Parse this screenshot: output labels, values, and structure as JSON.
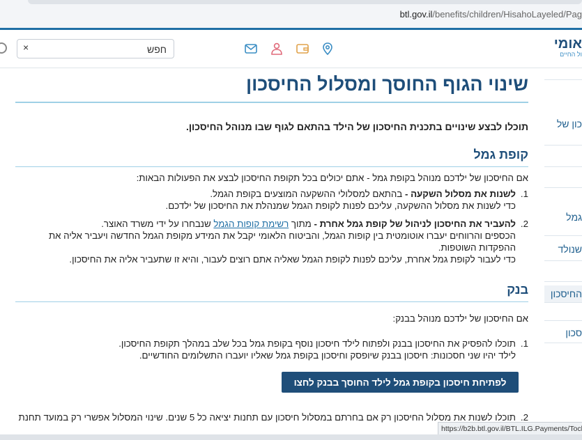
{
  "browser": {
    "url_domain": "btl.gov.il",
    "url_path": "/benefits/children/HisahoLayeled/Pag"
  },
  "header": {
    "logo_line1": "אומי",
    "logo_line2": "ול החיים",
    "icons": [
      "mail-icon",
      "person-icon",
      "wallet-icon",
      "location-pin-icon"
    ],
    "search_placeholder": "חפש",
    "clear_label": "×"
  },
  "sidebar": {
    "items": [
      "כון של",
      "גמל",
      "שנולד",
      "החיסכון",
      "סכון"
    ]
  },
  "main": {
    "title": "שינוי הגוף החוסך ומסלול החיסכון",
    "intro": "תוכלו לבצע שינויים בתכנית החיסכון של הילד בהתאם לגוף שבו מנוהל החיסכון.",
    "kupat_gemel": {
      "heading": "קופת גמל",
      "lead": "אם החיסכון של ילדכם מנוהל בקופת גמל - אתם יכולים בכל תקופת החיסכון לבצע את הפעולות הבאות:",
      "item1": {
        "num": "1.",
        "bold": "לשנות את מסלול השקעה -",
        "rest": " בהתאם למסלולי ההשקעה המוצעים בקופת הגמל.",
        "line2": "כדי לשנות את מסלול ההשקעה, עליכם לפנות לקופת הגמל שמנהלת את החיסכון של ילדכם."
      },
      "item2": {
        "num": "2.",
        "bold": "להעביר את החיסכון לניהול של קופת גמל אחרת -",
        "pre_link": " מתוך ",
        "link": "רשימת קופות הגמל",
        "post_link": " שנבחרו על ידי משרד האוצר.",
        "line2": "הכספים והרווחים יעברו אוטומטית בין קופות הגמל, והביטוח הלאומי יקבל את המידע מקופת הגמל החדשה ויעביר אליה את ההפקדות השוטפות.",
        "line3": "כדי לעבור לקופת גמל אחרת, עליכם לפנות לקופת הגמל שאליה אתם רוצים לעבור, והיא זו שתעביר אליה את החיסכון."
      }
    },
    "bank": {
      "heading": "בנק",
      "lead": "אם החיסכון של ילדכם מנוהל בבנק:",
      "item1": {
        "num": "1.",
        "line1": "תוכלו להפסיק את החיסכון בבנק ולפתוח לילד חיסכון נוסף בקופת גמל בכל שלב במהלך תקופת החיסכון.",
        "line2": "לילד יהיו שני חסכונות: חיסכון בבנק שיופסק וחיסכון בקופת גמל שאליו יועברו התשלומים החודשיים."
      },
      "cta": "לפתיחת חיסכון בקופת גמל לילד החוסך בבנק לחצו כאן.",
      "item2": {
        "num": "2.",
        "line1": "תוכלו לשנות את מסלול החיסכון רק אם בחרתם במסלול חיסכון עם תחנות יציאה כל 5 שנים. שינוי המסלול אפשרי רק במועד תחנת"
      }
    }
  },
  "status_bar": {
    "link_preview": "https://b2b.btl.gov.il/BTL.ILG.Payments/TochnitCh"
  },
  "colors": {
    "brand_blue": "#1e4e7a",
    "accent_line": "#9fd0e6",
    "button_bg": "#1f4e79",
    "link": "#1f6fa5"
  }
}
